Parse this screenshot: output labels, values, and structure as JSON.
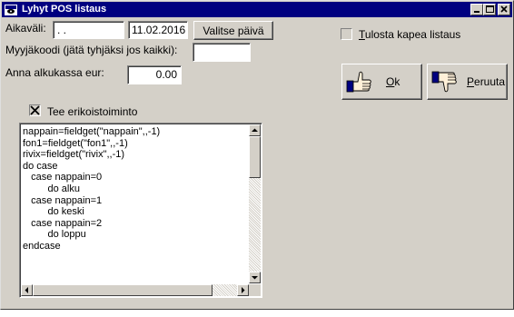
{
  "window": {
    "title": "Lyhyt POS listaus"
  },
  "form": {
    "period_label": "Aikaväli:",
    "date_from_value": " .  .",
    "date_to_value": "11.02.2016",
    "choose_date_button": "Valitse päivä",
    "seller_code_label": "Myyjäkoodi (jätä tyhjäksi jos kaikki):",
    "seller_code_value": "",
    "opening_cash_label": "Anna alkukassa eur:",
    "opening_cash_value": "0.00",
    "narrow_print_label_rest": "ulosta kapea listaus",
    "narrow_print_label_key": "T",
    "narrow_print_checked": false,
    "ok_label_key": "O",
    "ok_label_rest": "k",
    "cancel_label_key": "P",
    "cancel_label_rest": "eruuta",
    "special_function_label": "Tee erikoistoiminto",
    "special_function_checked": true
  },
  "memo": {
    "lines": [
      "nappain=fieldget(\"nappain\",,-1)",
      "fon1=fieldget(\"fon1\",,-1)",
      "rivix=fieldget(\"rivix\",,-1)",
      "do case",
      "   case nappain=0",
      "         do alku",
      "   case nappain=1",
      "         do keski",
      "   case nappain=2",
      "         do loppu",
      "endcase"
    ]
  },
  "colors": {
    "titlebar": "#000080",
    "face": "#d4d0c8"
  }
}
